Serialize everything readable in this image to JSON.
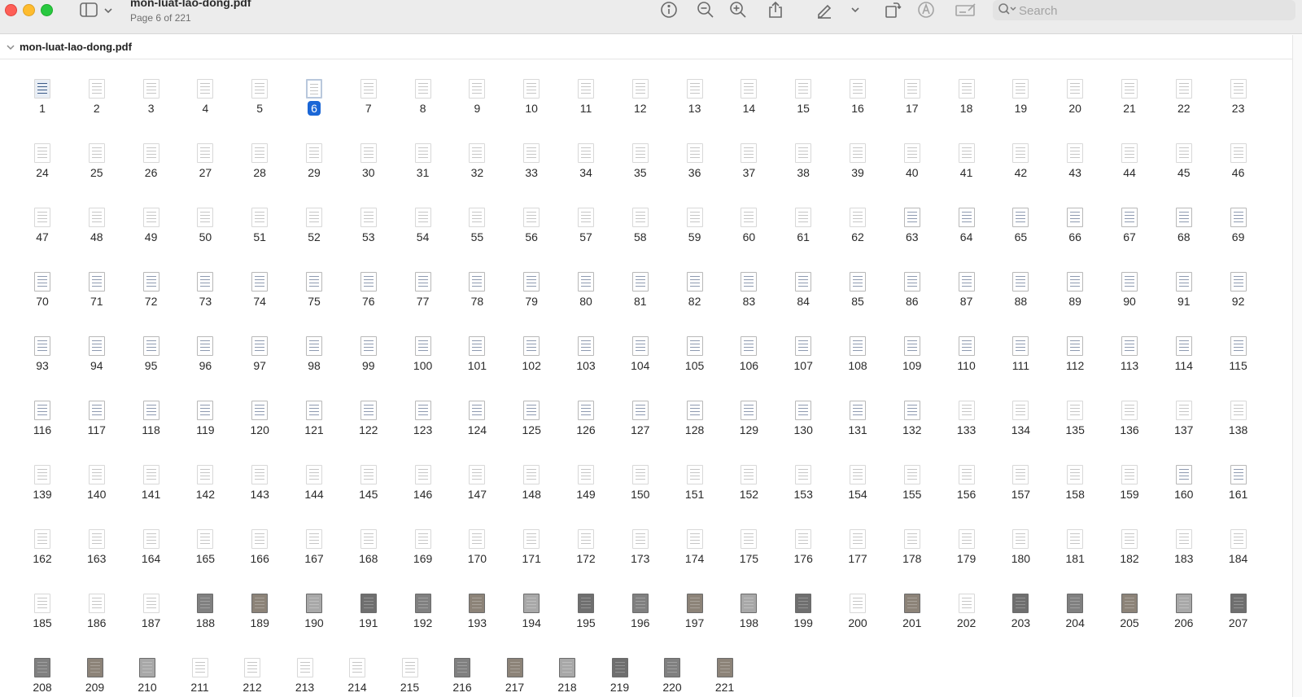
{
  "window": {
    "title": "mon-luat-lao-dong.pdf",
    "subtitle": "Page 6 of 221"
  },
  "toolbar": {
    "icons": [
      "info-icon",
      "zoom-out-icon",
      "zoom-in-icon",
      "share-icon",
      "markup-pen-icon",
      "chevron-down-icon",
      "rotate-icon",
      "annotate-circle-icon",
      "signature-icon"
    ],
    "search_placeholder": "Search"
  },
  "sidebar": {
    "document_name": "mon-luat-lao-dong.pdf"
  },
  "thumbnails": {
    "total_pages": 221,
    "selected_page": 6,
    "pages": [
      "1",
      "2",
      "3",
      "4",
      "5",
      "6",
      "7",
      "8",
      "9",
      "10",
      "11",
      "12",
      "13",
      "14",
      "15",
      "16",
      "17",
      "18",
      "19",
      "20",
      "21",
      "22",
      "23",
      "24",
      "25",
      "26",
      "27",
      "28",
      "29",
      "30",
      "31",
      "32",
      "33",
      "34",
      "35",
      "36",
      "37",
      "38",
      "39",
      "40",
      "41",
      "42",
      "43",
      "44",
      "45",
      "46",
      "47",
      "48",
      "49",
      "50",
      "51",
      "52",
      "53",
      "54",
      "55",
      "56",
      "57",
      "58",
      "59",
      "60",
      "61",
      "62",
      "63",
      "64",
      "65",
      "66",
      "67",
      "68",
      "69",
      "70",
      "71",
      "72",
      "73",
      "74",
      "75",
      "76",
      "77",
      "78",
      "79",
      "80",
      "81",
      "82",
      "83",
      "84",
      "85",
      "86",
      "87",
      "88",
      "89",
      "90",
      "91",
      "92",
      "93",
      "94",
      "95",
      "96",
      "97",
      "98",
      "99",
      "100",
      "101",
      "102",
      "103",
      "104",
      "105",
      "106",
      "107",
      "108",
      "109",
      "110",
      "111",
      "112",
      "113",
      "114",
      "115",
      "116",
      "117",
      "118",
      "119",
      "120",
      "121",
      "122",
      "123",
      "124",
      "125",
      "126",
      "127",
      "128",
      "129",
      "130",
      "131",
      "132",
      "133",
      "134",
      "135",
      "136",
      "137",
      "138",
      "139",
      "140",
      "141",
      "142",
      "143",
      "144",
      "145",
      "146",
      "147",
      "148",
      "149",
      "150",
      "151",
      "152",
      "153",
      "154",
      "155",
      "156",
      "157",
      "158",
      "159",
      "160",
      "161",
      "162",
      "163",
      "164",
      "165",
      "166",
      "167",
      "168",
      "169",
      "170",
      "171",
      "172",
      "173",
      "174",
      "175",
      "176",
      "177",
      "178",
      "179",
      "180",
      "181",
      "182",
      "183",
      "184",
      "185",
      "186",
      "187",
      "188",
      "189",
      "190",
      "191",
      "192",
      "193",
      "194",
      "195",
      "196",
      "197",
      "198",
      "199",
      "200",
      "201",
      "202",
      "203",
      "204",
      "205",
      "206",
      "207",
      "208",
      "209",
      "210",
      "211",
      "212",
      "213",
      "214",
      "215",
      "216",
      "217",
      "218",
      "219",
      "220",
      "221"
    ]
  },
  "colors": {
    "selection": "#1a66d6",
    "titlebar": "#ececec"
  }
}
